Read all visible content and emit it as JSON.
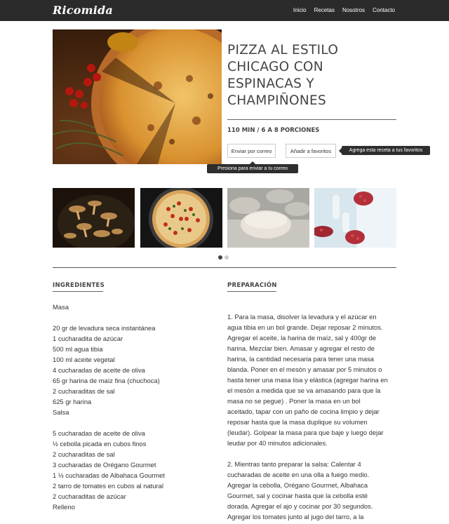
{
  "app": {
    "logo": "Ricomida",
    "nav": [
      "Inicio",
      "Recetas",
      "Nosotros",
      "Contacto"
    ]
  },
  "recipe": {
    "title_lines": [
      "PIZZA AL ESTILO",
      "CHICAGO CON",
      "ESPINACAS Y",
      "CHAMPIÑONES"
    ],
    "meta": "110 MIN / 6 A 8 PORCIONES",
    "email_button": "Enviar por correo",
    "fav_button": "Añadir a favoritos",
    "fav_tooltip": "Agrega esta receta a tus favoritos",
    "email_tooltip": "Presiona para enviar a tu correo"
  },
  "gallery": {
    "thumbs": [
      "mushrooms-thumbnail",
      "pizza-thumbnail",
      "dough-thumbnail",
      "pomegranate-thumbnail"
    ],
    "dots": 2,
    "active_dot": 0
  },
  "ingredients": {
    "heading": "INGREDIENTES",
    "lines": [
      "Masa",
      "",
      "20 gr de levadura seca instantánea",
      "1 cucharadita de azúcar",
      "500 ml agua tibia",
      "100 ml aceite vegetal",
      "4 cucharadas de aceite de oliva",
      "65 gr harina de maíz fina (chuchoca)",
      "2 cucharaditas de sal",
      "625 gr harina",
      "Salsa",
      "",
      "5 cucharadas de aceite de oliva",
      "½  cebolla picada en cubos finos",
      "2 cucharaditas de sal",
      "3  cucharadas de Orégano Gourmet",
      "1 ½ cucharadas de Albahaca Gourmet",
      "2 tarro de tomates en cubos al natural",
      "2 cucharaditas de azúcar",
      "Relleno"
    ]
  },
  "preparation": {
    "heading": "PREPARACIÓN",
    "lines": [
      "1. Para la masa, disolver la levadura y el azúcar en",
      "agua tibia en un bol grande.  Dejar reposar 2 minutos.",
      "Agregar el aceite, la harina de maíz, sal y 400gr de",
      "harina.  Mezclar bien.  Amasar y agregar el resto de",
      "harina, la cantidad necesaria para tener una masa",
      "blanda. Poner en el mesón y amasar por 5 minutos o",
      "hasta tener una masa lisa y elástica (agregar harina en",
      "el mesón a medida que se va amasando para que la",
      "masa no se pegue) . Poner la masa en un bol",
      "aceitado, tapar con un paño de cocina limpio y dejar",
      "reposar hasta que la masa duplique su volumen",
      "(leudar).  Golpear la masa para que baje y luego dejar",
      "leudar por 40 minutos adicionales.",
      "",
      "2. Mientras tanto preparar la salsa: Calentar 4",
      "cucharadas de aceite en una olla a fuego medio.",
      "Agregar la cebolla, Orégano Gourmet, Albahaca",
      "Gourmet, sal y cocinar hasta que la cebolla esté",
      "dorada. Agregar el ajo y cocinar por 30 segundos.",
      "Agregar los tomates junto al jugo del tarro, a la"
    ]
  }
}
